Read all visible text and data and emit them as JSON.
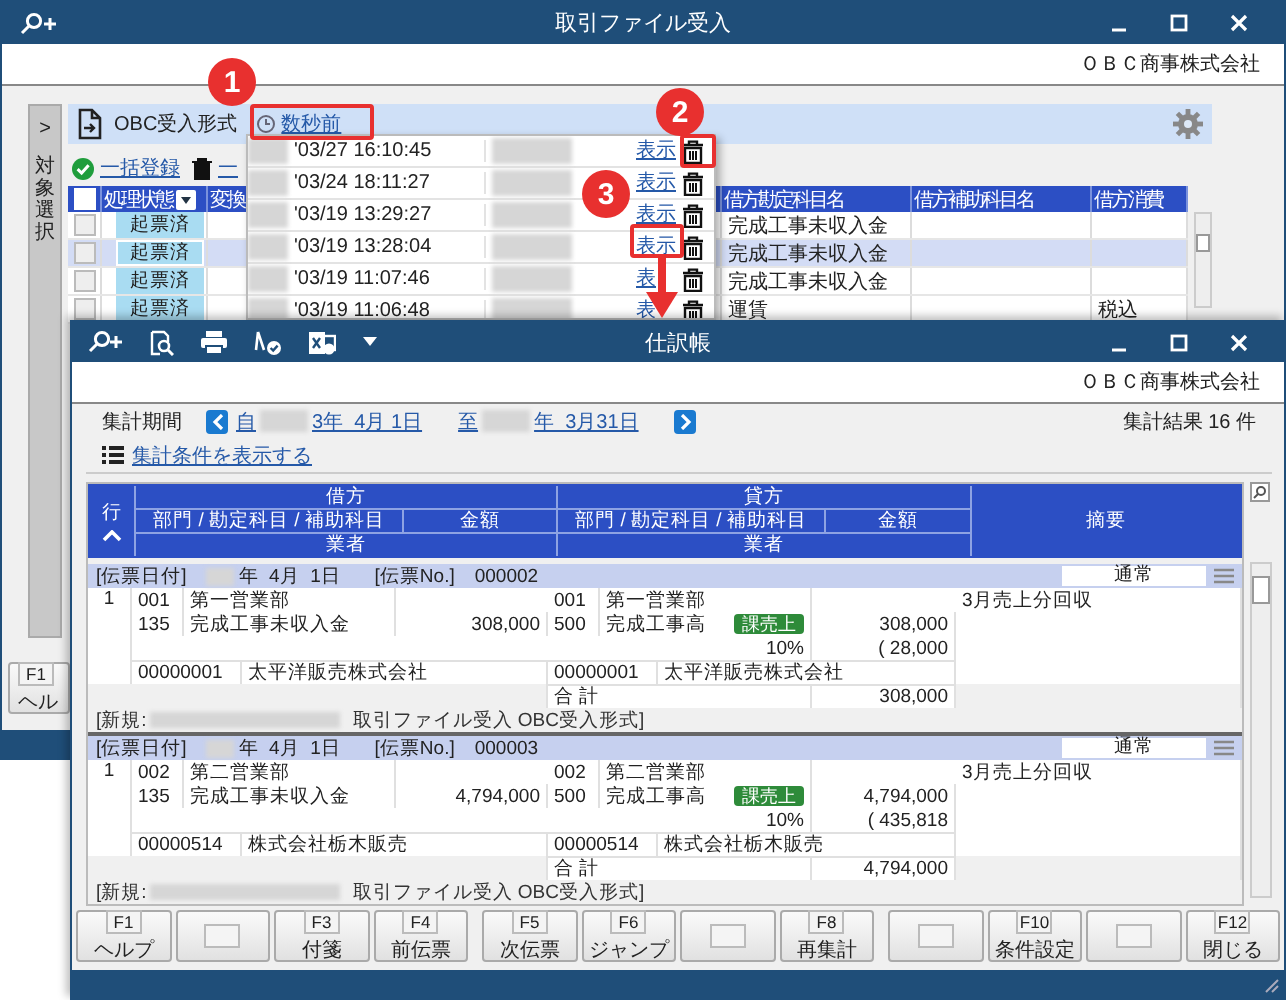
{
  "back_window": {
    "title": "取引ファイル受入",
    "company": "ＯＢＣ商事株式会社",
    "side_tab": {
      "arrow": ">",
      "label": "対象選択"
    },
    "panel_title": "OBC受入形式",
    "recent_link": "数秒前",
    "actions": [
      {
        "kind": "register",
        "label": "一括登録"
      },
      {
        "kind": "delete",
        "label": "一"
      }
    ],
    "grid": {
      "header_checked": false,
      "columns": [
        {
          "kind": "status",
          "label": "処理状態"
        },
        {
          "kind": "count",
          "label": "変換"
        },
        {
          "kind": "gap"
        },
        {
          "kind": "account",
          "label": "借方勘定科目名"
        },
        {
          "kind": "sub",
          "label": "借方補助科目名"
        },
        {
          "kind": "tax",
          "label": "借方消費"
        }
      ],
      "rows": [
        {
          "selected": false,
          "checked": false,
          "status": "起票済",
          "account": "完成工事未収入金"
        },
        {
          "selected": true,
          "checked": false,
          "status": "起票済",
          "account": "完成工事未収入金"
        },
        {
          "selected": false,
          "checked": false,
          "status": "起票済",
          "account": "完成工事未収入金"
        },
        {
          "selected": false,
          "checked": false,
          "status": "起票済",
          "account": "運賃",
          "tax": "税込"
        }
      ]
    },
    "function_keys": [
      {
        "key": "F1",
        "label": "ヘル"
      }
    ]
  },
  "history_popup": {
    "rows": [
      {
        "time": "'03/27 16:10:45",
        "link": "表示"
      },
      {
        "time": "'03/24 18:11:27",
        "link": "表示"
      },
      {
        "time": "'03/19 13:29:27",
        "link": "表示"
      },
      {
        "time": "'03/19 13:28:04",
        "link": "表示"
      },
      {
        "time": "'03/19 11:07:46",
        "link": "表"
      },
      {
        "time": "'03/19 11:06:48",
        "link": "表"
      }
    ]
  },
  "journal_window": {
    "title": "仕訳帳",
    "company": "ＯＢＣ商事株式会社",
    "period_label": "集計期間",
    "period_from": {
      "prefix": "自",
      "value": "3年  4月 1日"
    },
    "period_to": {
      "prefix": "至",
      "value": "年  3月31日"
    },
    "result_count": "集計結果 16 件",
    "conditions_link": "集計条件を表示する",
    "table_header": {
      "row": "行",
      "debit": "借方",
      "credit": "貸方",
      "debit_account": "部門 / 勘定科目 / 補助科目",
      "debit_amount": "金額",
      "debit_vendor": "業者",
      "credit_account": "部門 / 勘定科目 / 補助科目",
      "credit_amount": "金額",
      "credit_vendor": "業者",
      "memo": "摘要"
    },
    "vouchers": [
      {
        "date_label": "[伝票日付]",
        "date": "年  4月  1日",
        "no_label": "[伝票No.]",
        "no": "000002",
        "type": "通常",
        "line": "1",
        "debit": {
          "dept_code": "001",
          "dept": "第一営業部",
          "account_code": "135",
          "account": "完成工事未収入金",
          "amount": "308,000",
          "vendor_code": "00000001",
          "vendor": "太平洋販売株式会社"
        },
        "credit": {
          "dept_code": "001",
          "dept": "第一営業部",
          "account_code": "500",
          "account": "完成工事高",
          "tax_tag": "課売上",
          "amount": "308,000",
          "tax_rate": "10%",
          "tax_amount": "( 28,000",
          "vendor_code": "00000001",
          "vendor": "太平洋販売株式会社"
        },
        "memo": "3月売上分回収",
        "total_label": "合 計",
        "total": "308,000",
        "footer_prefix": "[新規:",
        "footer": "取引ファイル受入 OBC受入形式]"
      },
      {
        "date_label": "[伝票日付]",
        "date": "年  4月  1日",
        "no_label": "[伝票No.]",
        "no": "000003",
        "type": "通常",
        "line": "1",
        "debit": {
          "dept_code": "002",
          "dept": "第二営業部",
          "account_code": "135",
          "account": "完成工事未収入金",
          "amount": "4,794,000",
          "vendor_code": "00000514",
          "vendor": "株式会社栃木販売"
        },
        "credit": {
          "dept_code": "002",
          "dept": "第二営業部",
          "account_code": "500",
          "account": "完成工事高",
          "tax_tag": "課売上",
          "amount": "4,794,000",
          "tax_rate": "10%",
          "tax_amount": "( 435,818",
          "vendor_code": "00000514",
          "vendor": "株式会社栃木販売"
        },
        "memo": "3月売上分回収",
        "total_label": "合 計",
        "total": "4,794,000",
        "footer_prefix": "[新規:",
        "footer": "取引ファイル受入 OBC受入形式]"
      }
    ],
    "function_keys": [
      {
        "kind": "key",
        "key": "F1",
        "label": "ヘルプ"
      },
      {
        "kind": "blank"
      },
      {
        "kind": "key",
        "key": "F3",
        "label": "付箋"
      },
      {
        "kind": "key",
        "key": "F4",
        "label": "前伝票"
      },
      {
        "kind": "key",
        "key": "F5",
        "label": "次伝票"
      },
      {
        "kind": "key",
        "key": "F6",
        "label": "ジャンプ"
      },
      {
        "kind": "blank"
      },
      {
        "kind": "key",
        "key": "F8",
        "label": "再集計"
      },
      {
        "kind": "blank"
      },
      {
        "kind": "key",
        "key": "F10",
        "label": "条件設定"
      },
      {
        "kind": "blank"
      },
      {
        "kind": "key",
        "key": "F12",
        "label": "閉じる"
      }
    ]
  },
  "annotations": [
    {
      "number": "1"
    },
    {
      "number": "2"
    },
    {
      "number": "3"
    }
  ]
}
